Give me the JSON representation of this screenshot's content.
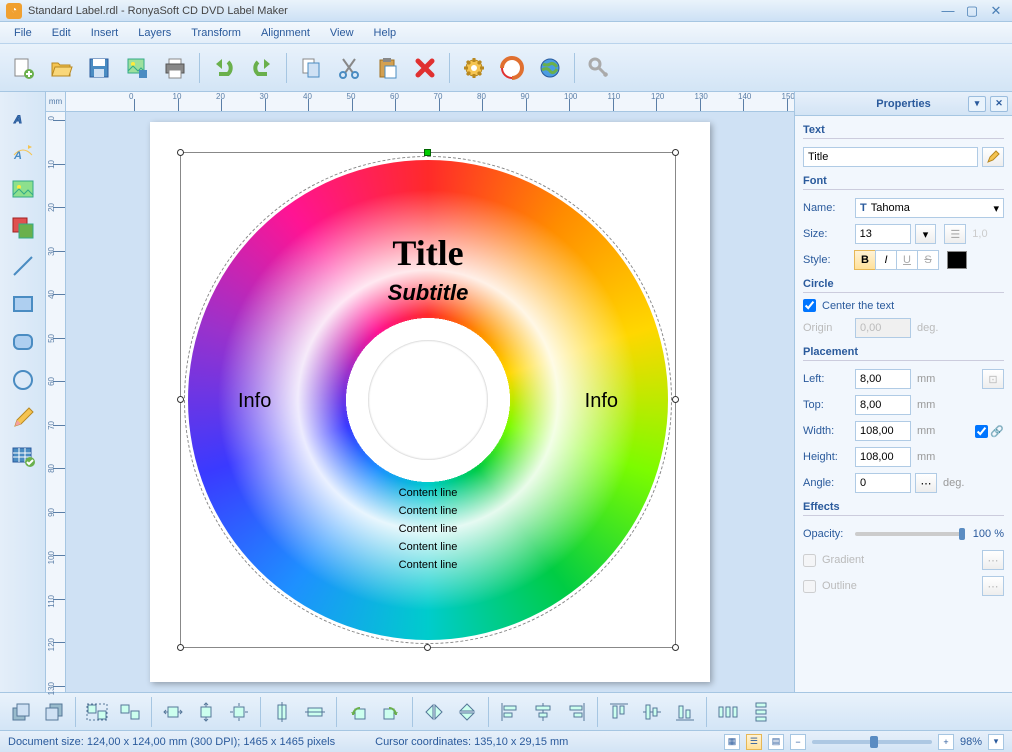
{
  "titlebar": {
    "text": "Standard Label.rdl - RonyaSoft CD DVD Label Maker"
  },
  "menu": [
    "File",
    "Edit",
    "Insert",
    "Layers",
    "Transform",
    "Alignment",
    "View",
    "Help"
  ],
  "canvas": {
    "unit": "mm"
  },
  "disc": {
    "title": "Title",
    "subtitle": "Subtitle",
    "info_l": "Info",
    "info_r": "Info",
    "content": [
      "Content line",
      "Content line",
      "Content line",
      "Content line",
      "Content line"
    ]
  },
  "props": {
    "header": "Properties",
    "sect_text": "Text",
    "text_value": "Title",
    "sect_font": "Font",
    "name_lbl": "Name:",
    "name_val": "Tahoma",
    "size_lbl": "Size:",
    "size_val": "13",
    "line_val": "1,0",
    "style_lbl": "Style:",
    "sect_circle": "Circle",
    "center_lbl": "Center the text",
    "origin_lbl": "Origin",
    "origin_val": "0,00",
    "deg_lbl": "deg.",
    "sect_place": "Placement",
    "left_lbl": "Left:",
    "left_val": "8,00",
    "top_lbl": "Top:",
    "top_val": "8,00",
    "width_lbl": "Width:",
    "width_val": "108,00",
    "height_lbl": "Height:",
    "height_val": "108,00",
    "angle_lbl": "Angle:",
    "angle_val": "0",
    "mm": "mm",
    "sect_fx": "Effects",
    "opacity_lbl": "Opacity:",
    "opacity_val": "100 %",
    "grad_lbl": "Gradient",
    "outline_lbl": "Outline"
  },
  "status": {
    "doc": "Document size: 124,00 x 124,00 mm (300 DPI); 1465 x 1465 pixels",
    "cursor": "Cursor coordinates: 135,10 x 29,15 mm",
    "zoom": "98%"
  }
}
